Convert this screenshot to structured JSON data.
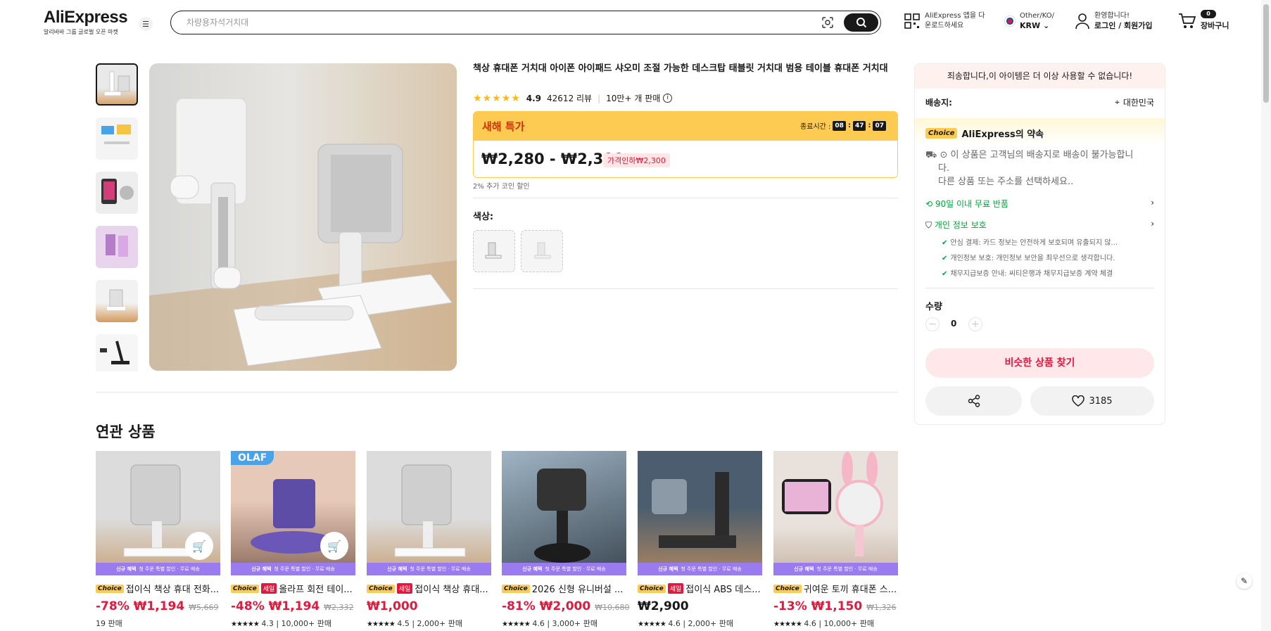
{
  "header": {
    "logo": "AliExpress",
    "logo_sub": "알리바바 그룹 글로벌 오픈 마켓",
    "search_placeholder": "차량용자석거치대",
    "app_line1": "AliExpress 앱을 다",
    "app_line2": "운로드하세요",
    "region_line1": "Other/KO/",
    "region_line2": "KRW",
    "account_line1": "환영합니다!",
    "account_line2": "로그인 / 회원가입",
    "cart_count": "0",
    "cart_label": "장바구니"
  },
  "product": {
    "title": "책상 휴대폰 거치대 아이폰 아이패드 샤오미 조절 가능한 데스크탑 태블릿 거치대 범용 테이블 휴대폰 거치대",
    "rating": "4.9",
    "reviews": "42612 리뷰",
    "sold": "10만+ 개 판매",
    "deal_title": "새해 특가",
    "timer_label": "종료시간 :",
    "timer_h": "08",
    "timer_m": "47",
    "timer_s": "07",
    "price": "₩2,280 - ₩2,300",
    "price_tag": "가격인하₩2,300",
    "coin_note": "2% 추가 코인 할인",
    "color_label": "색상:"
  },
  "panel": {
    "notice": "죄송합니다,이 아이템은 더 이상 사용할 수 없습니다!",
    "ship_label": "배송지:",
    "ship_dest": "대한민국",
    "choice_badge": "Choice",
    "choice_promise": "AliExpress의 약속",
    "undeliverable_1": "이 상품은 고객님의 배송지로 배송이 불가능합니",
    "undeliverable_2": "다.",
    "undeliverable_3": "다른 상품 또는 주소를 선택하세요..",
    "returns": "90일 이내 무료 반품",
    "privacy": "개인 정보 보호",
    "checks": [
      "안심 결제: 카드 정보는 안전하게 보호되며 유출되지 않...",
      "개인정보 보호: 개인정보 보안을 최우선으로 생각합니다.",
      "채무지급보증 안내: 씨티은행과 채무지급보증 계약 체결"
    ],
    "qty_label": "수량",
    "qty_value": "0",
    "find_similar": "비슷한 상품 찾기",
    "likes": "3185"
  },
  "related": {
    "title": "연관 상품",
    "band_bold": "신규 혜택",
    "band_text": "첫 주문 특별 할인 · 무료 배송",
    "items": [
      {
        "choice": "Choice",
        "sale": "",
        "title": "접이식 책상 휴대 전화...",
        "discount": "-78%",
        "price": "₩1,194",
        "orig": "₩5,669",
        "stars": "",
        "score": "",
        "sold": "19 판매"
      },
      {
        "choice": "Choice",
        "sale": "세일",
        "title": "올라프 회전 테이...",
        "discount": "-48%",
        "price": "₩1,194",
        "orig": "₩2,332",
        "stars": "★★★★★",
        "score": "4.3",
        "sold": "10,000+ 판매"
      },
      {
        "choice": "Choice",
        "sale": "세일",
        "title": "접이식 책상 휴대...",
        "discount": "",
        "price": "₩1,000",
        "orig": "",
        "stars": "★★★★★",
        "score": "4.5",
        "sold": "2,000+ 판매"
      },
      {
        "choice": "Choice",
        "sale": "",
        "title": "2026 신형 유니버설 ...",
        "discount": "-81%",
        "price": "₩2,000",
        "orig": "₩10,680",
        "stars": "★★★★★",
        "score": "4.6",
        "sold": "3,000+ 판매"
      },
      {
        "choice": "Choice",
        "sale": "세일",
        "title": "접이식 ABS 데스...",
        "discount": "",
        "price": "₩2,900",
        "orig": "",
        "stars": "★★★★★",
        "score": "4.6",
        "sold": "2,000+ 판매"
      },
      {
        "choice": "Choice",
        "sale": "",
        "title": "귀여운 토끼 휴대폰 스...",
        "discount": "-13%",
        "price": "₩1,150",
        "orig": "₩1,326",
        "stars": "★★★★★",
        "score": "4.6",
        "sold": "10,000+ 판매"
      }
    ],
    "olaf_badge": "OLAF"
  },
  "colors": {
    "accent": "#e4173d",
    "deal": "#fdcb51",
    "green": "#00a63a",
    "band": "#9b7cf0"
  }
}
